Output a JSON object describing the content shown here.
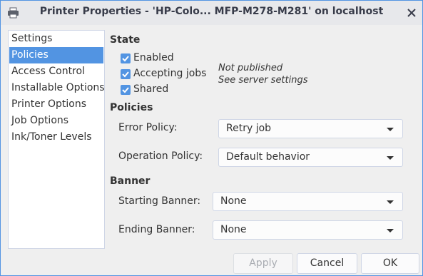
{
  "window": {
    "title": "Printer Properties - 'HP-Colo... MFP-M278-M281' on localhost"
  },
  "sidebar": {
    "items": [
      {
        "label": "Settings",
        "selected": false
      },
      {
        "label": "Policies",
        "selected": true
      },
      {
        "label": "Access Control",
        "selected": false
      },
      {
        "label": "Installable Options",
        "selected": false
      },
      {
        "label": "Printer Options",
        "selected": false
      },
      {
        "label": "Job Options",
        "selected": false
      },
      {
        "label": "Ink/Toner Levels",
        "selected": false
      }
    ]
  },
  "state": {
    "heading": "State",
    "enabled": {
      "label": "Enabled",
      "checked": true
    },
    "accepting": {
      "label": "Accepting jobs",
      "checked": true
    },
    "shared": {
      "label": "Shared",
      "checked": true
    },
    "note_line1": "Not published",
    "note_line2": "See server settings"
  },
  "policies": {
    "heading": "Policies",
    "error_policy": {
      "label": "Error Policy:",
      "value": "Retry job"
    },
    "operation_policy": {
      "label": "Operation Policy:",
      "value": "Default behavior"
    }
  },
  "banner": {
    "heading": "Banner",
    "starting": {
      "label": "Starting Banner:",
      "value": "None"
    },
    "ending": {
      "label": "Ending Banner:",
      "value": "None"
    }
  },
  "buttons": {
    "apply": "Apply",
    "cancel": "Cancel",
    "ok": "OK"
  },
  "colors": {
    "accent": "#5294e2",
    "titlebar": "#e7e8eb",
    "window_bg": "#efefef"
  }
}
